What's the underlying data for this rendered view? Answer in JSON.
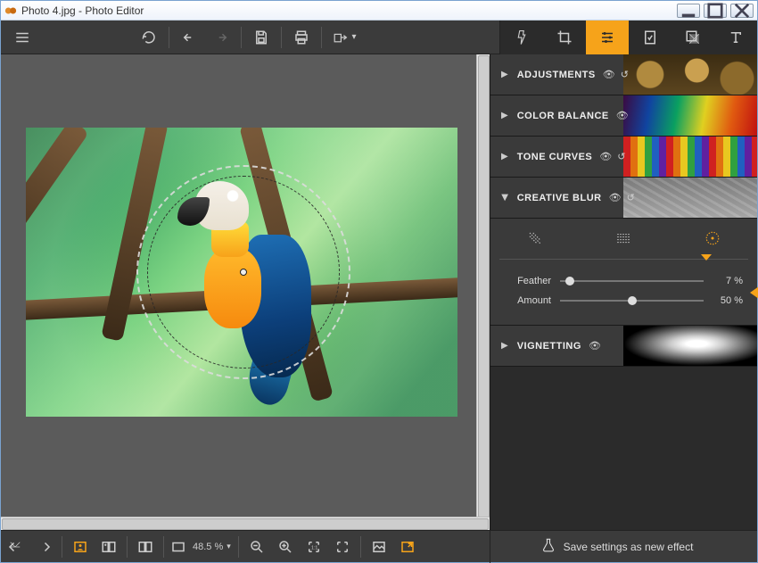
{
  "window": {
    "title": "Photo 4.jpg - Photo Editor"
  },
  "toolbar": {
    "menu": "Menu",
    "undo_all": "Undo all",
    "undo": "Undo",
    "redo": "Redo",
    "save": "Save",
    "print": "Print",
    "export": "Export"
  },
  "right_tabs": [
    "flask",
    "crop",
    "sliders",
    "stamp",
    "layers",
    "text"
  ],
  "right_tab_active": 2,
  "panels": {
    "adjustments": {
      "label": "ADJUSTMENTS",
      "open": false
    },
    "color_balance": {
      "label": "COLOR BALANCE",
      "open": false
    },
    "tone_curves": {
      "label": "TONE CURVES",
      "open": false
    },
    "creative_blur": {
      "label": "CREATIVE BLUR",
      "open": true,
      "modes": [
        "tilt-shift",
        "linear",
        "radial"
      ],
      "mode_active": 2,
      "sliders": {
        "feather": {
          "label": "Feather",
          "value": 7,
          "display": "7 %"
        },
        "amount": {
          "label": "Amount",
          "value": 50,
          "display": "50 %"
        }
      }
    },
    "vignetting": {
      "label": "VIGNETTING",
      "open": false
    }
  },
  "footer": {
    "zoom": {
      "display": "48.5 %"
    },
    "save_effect": "Save settings as new effect"
  }
}
